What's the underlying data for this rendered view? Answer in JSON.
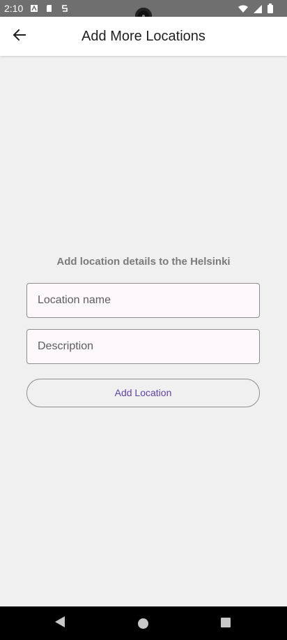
{
  "status": {
    "time": "2:10",
    "left_icons": [
      "a-icon",
      "sd-card-icon",
      "s-icon"
    ],
    "right_icons": [
      "wifi-icon",
      "signal-icon",
      "battery-icon"
    ]
  },
  "app_bar": {
    "title": "Add More Locations",
    "back_icon": "arrow-left-icon"
  },
  "form": {
    "prompt": "Add location details to the Helsinki",
    "location_name": {
      "placeholder": "Location name",
      "value": ""
    },
    "description": {
      "placeholder": "Description",
      "value": ""
    },
    "button_label": "Add Location"
  },
  "colors": {
    "accent": "#5f43a6",
    "field_bg": "#fdf8fc",
    "background": "#f0f0f0"
  }
}
